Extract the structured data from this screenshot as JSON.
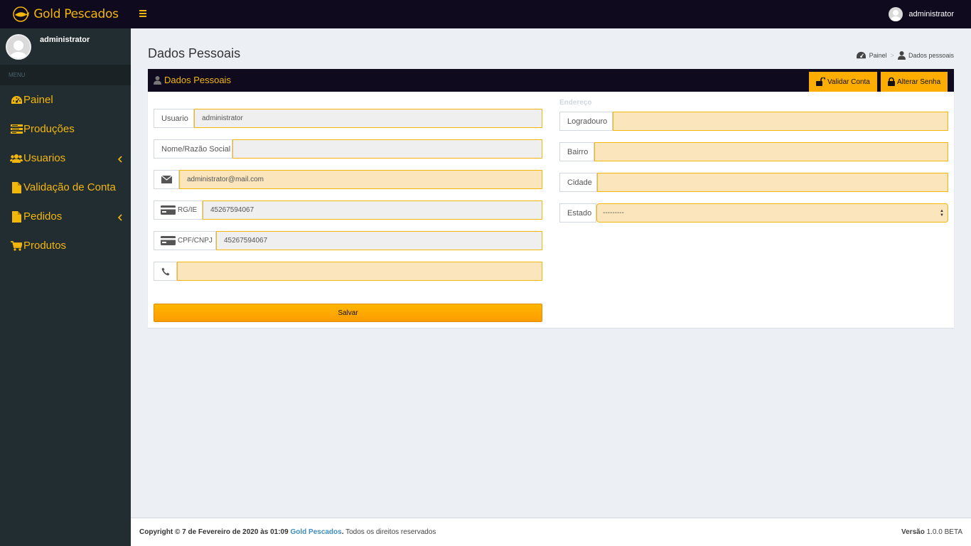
{
  "app": {
    "brand": "Gold Pescados",
    "user": "administrator"
  },
  "sidebar": {
    "menu_header": "MENU",
    "items": [
      {
        "label": "Painel",
        "icon": "dashboard-icon"
      },
      {
        "label": "Produções",
        "icon": "list-icon"
      },
      {
        "label": "Usuarios",
        "icon": "users-icon",
        "has_children": true
      },
      {
        "label": "Validação de Conta",
        "icon": "file-icon"
      },
      {
        "label": "Pedidos",
        "icon": "file-icon",
        "has_children": true
      },
      {
        "label": "Produtos",
        "icon": "cart-icon"
      }
    ]
  },
  "page": {
    "title": "Dados Pessoais",
    "breadcrumb": [
      "Painel",
      "Dados pessoais"
    ]
  },
  "box": {
    "title": "Dados Pessoais",
    "validate_label": "Validar Conta",
    "change_password_label": "Alterar Senha"
  },
  "form_left": {
    "usuario": {
      "label": "Usuario",
      "value": "administrator"
    },
    "nome": {
      "label": "Nome/Razão Social",
      "value": ""
    },
    "email": {
      "value": "administrator@mail.com"
    },
    "rg": {
      "label": "RG/IE",
      "value": "45267594067"
    },
    "cpf": {
      "label": "CPF/CNPJ",
      "value": "45267594067"
    },
    "phone": {
      "value": ""
    },
    "save_label": "Salvar"
  },
  "form_right": {
    "section_title": "Endereço",
    "logradouro": {
      "label": "Logradouro",
      "value": ""
    },
    "bairro": {
      "label": "Bairro",
      "value": ""
    },
    "cidade": {
      "label": "Cidade",
      "value": ""
    },
    "estado": {
      "label": "Estado",
      "selected": "---------"
    }
  },
  "footer": {
    "copyright_prefix": "Copyright © 7 de Fevereiro de 2020 às 01:09",
    "brand": "Gold Pescados",
    "rights": "Todos os direitos reservados",
    "version_label": "Versão",
    "version_value": "1.0.0 BETA"
  },
  "colors": {
    "accent": "#f3b60b",
    "button": "#fdac00",
    "dark": "#0f0a1e",
    "sidebar": "#222d32"
  }
}
